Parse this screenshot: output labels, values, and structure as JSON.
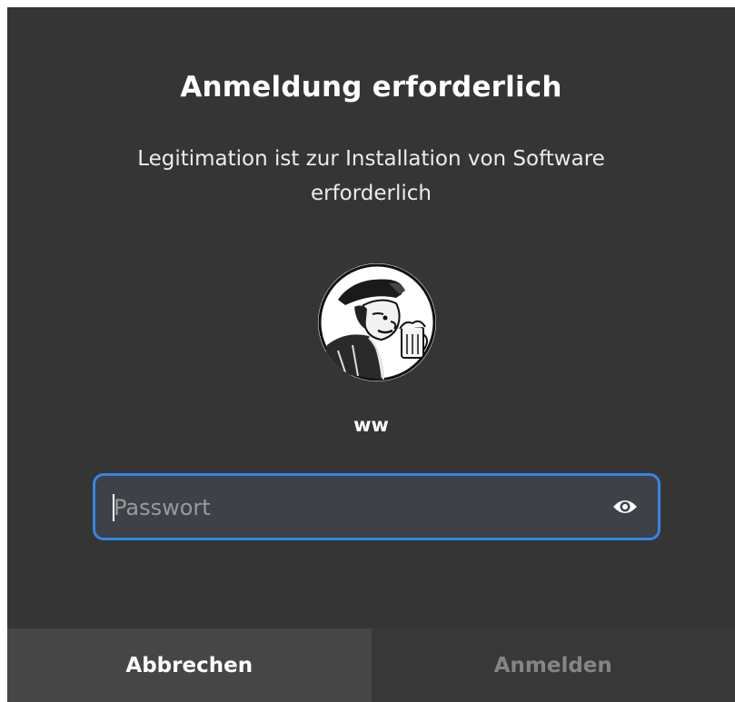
{
  "dialog": {
    "title": "Anmeldung erforderlich",
    "message": "Legitimation ist zur Installation von Software erforderlich",
    "username": "ww",
    "avatar_icon": "user-avatar-portrait",
    "password": {
      "value": "",
      "placeholder": "Passwort",
      "reveal_icon": "eye-icon"
    },
    "buttons": {
      "cancel_label": "Abbrechen",
      "login_label": "Anmelden",
      "login_enabled": false
    }
  },
  "colors": {
    "background": "#353535",
    "focus_border": "#3584e4",
    "field_background": "#3e4148",
    "cancel_background": "#464646",
    "disabled_text": "#858585"
  }
}
